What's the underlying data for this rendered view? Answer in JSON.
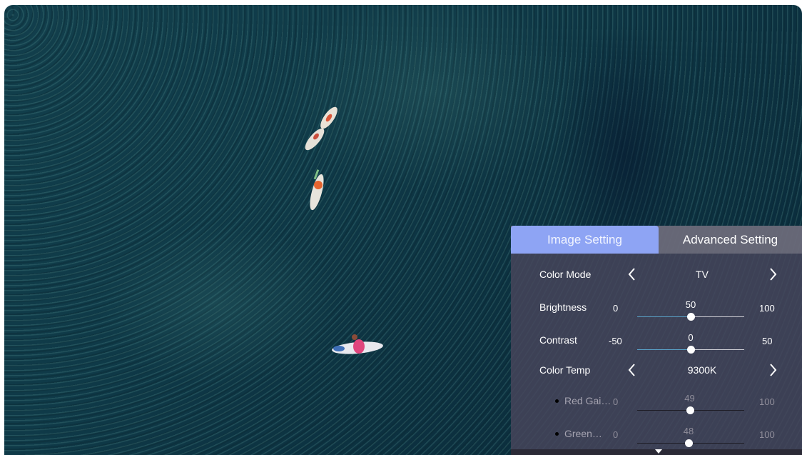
{
  "tabs": [
    {
      "label": "Image Setting",
      "active": true
    },
    {
      "label": "Advanced Setting",
      "active": false
    }
  ],
  "settings": {
    "color_mode": {
      "label": "Color Mode",
      "value": "TV"
    },
    "brightness": {
      "label": "Brightness",
      "min": "0",
      "max": "100",
      "value": "50",
      "fraction": 0.5
    },
    "contrast": {
      "label": "Contrast",
      "min": "-50",
      "max": "50",
      "value": "0",
      "fraction": 0.5
    },
    "color_temp": {
      "label": "Color Temp",
      "value": "9300K"
    },
    "red_gain": {
      "label": "Red Gai…",
      "min": "0",
      "max": "100",
      "value": "49",
      "fraction": 0.49
    },
    "green_gain": {
      "label": "Green…",
      "min": "0",
      "max": "100",
      "value": "48",
      "fraction": 0.48
    }
  },
  "icons": {
    "prev": "chevron-left-icon",
    "next": "chevron-right-icon",
    "more": "triangle-down-icon"
  },
  "colors": {
    "active_tab": "#8ea4f4",
    "slider_fill": "#5aa2c8"
  }
}
